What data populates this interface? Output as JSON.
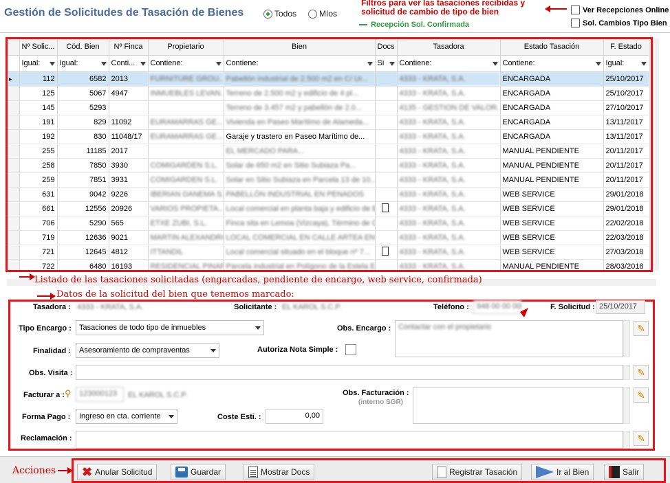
{
  "header": {
    "title": "Gestión de Solicitudes de Tasación de Bienes",
    "radio_todos": "Todos",
    "radio_mios": "Míos",
    "legend": "Recepción Sol. Confirmada",
    "chk_recepciones": "Ver Recepciones Online",
    "chk_cambios": "Sol. Cambios Tipo Bien"
  },
  "annotations": {
    "filters": "Filtros para ver las tasaciones recibidas y solicitud de cambio de tipo de bien",
    "listado": "Listado de las tasaciones solicitadas (engarcadas, pendiente de encargo, web service, confirmada)",
    "datos": "Datos de la solicitud del bien que tenemos marcado:",
    "acciones": "Acciones"
  },
  "grid": {
    "columns": [
      "Nº Solic...",
      "Cód. Bien",
      "Nº Finca",
      "Propietario",
      "Bien",
      "Docs",
      "Tasadora",
      "Estado Tasación",
      "F. Estado"
    ],
    "filters": [
      "Igual:",
      "Igual:",
      "Conti...",
      "Contiene:",
      "Contiene:",
      "Si",
      "Contiene:",
      "Contiene:",
      "Igual:"
    ],
    "rows": [
      {
        "sol": "112",
        "cod": "6582",
        "finca": "2013",
        "prop": "FURNITURE GROU...",
        "bien": "Pabellón industrial de 2.500 m2 en C/ Ur...",
        "docs": "",
        "tas": "4333 - KRATA, S.A.",
        "estado": "ENCARGADA",
        "fecha": "25/10/2017"
      },
      {
        "sol": "125",
        "cod": "5067",
        "finca": "4947",
        "prop": "INMUEBLES LEVAN...",
        "bien": "Terreno de 2.500 m2 y edificio de 4 pl...",
        "docs": "",
        "tas": "4333 - KRATA, S.A.",
        "estado": "ENCARGADA",
        "fecha": "25/10/2017"
      },
      {
        "sol": "145",
        "cod": "5293",
        "finca": "",
        "prop": "",
        "bien": "Terreno de 3.457 m2 y pabellón de 2.0...",
        "docs": "",
        "tas": "4135 - GESTION DE VALOR...",
        "estado": "ENCARGADA",
        "fecha": "27/10/2017"
      },
      {
        "sol": "191",
        "cod": "829",
        "finca": "11092",
        "prop": "EURAMARRAS GE...",
        "bien": "Vivienda en Paseo Marítimo de Alameda...",
        "docs": "",
        "tas": "4333 - KRATA, S.A.",
        "estado": "ENCARGADA",
        "fecha": "13/11/2017"
      },
      {
        "sol": "192",
        "cod": "830",
        "finca": "11048/17",
        "prop": "EURAMARRAS GE...",
        "bien": "Garaje y trastero en Paseo Marítimo de...",
        "docs": "",
        "tas": "4333 - KRATA, S.A.",
        "estado": "ENCARGADA",
        "fecha": "13/11/2017"
      },
      {
        "sol": "255",
        "cod": "11185",
        "finca": "2017",
        "prop": "",
        "bien": "EL MERCADO PARA...",
        "docs": "",
        "tas": "4333 - KRATA, S.A.",
        "estado": "MANUAL PENDIENTE",
        "fecha": "20/11/2017"
      },
      {
        "sol": "258",
        "cod": "7850",
        "finca": "3930",
        "prop": "COMIGARDEN S.L.",
        "bien": "Solar de 650 m2 en Sitio Subiaza Pa...",
        "docs": "",
        "tas": "4333 - KRATA, S.A.",
        "estado": "MANUAL PENDIENTE",
        "fecha": "20/11/2017"
      },
      {
        "sol": "259",
        "cod": "7851",
        "finca": "3931",
        "prop": "COMIGARDEN S.L.",
        "bien": "Solar en Sitio Subiaza en Parcela 13 de 10...",
        "docs": "",
        "tas": "4333 - KRATA, S.A.",
        "estado": "MANUAL PENDIENTE",
        "fecha": "20/11/2017"
      },
      {
        "sol": "631",
        "cod": "9042",
        "finca": "9226",
        "prop": "IBERIAN DANEMA S...",
        "bien": "PABELLÓN INDUSTRIAL EN PENADOS",
        "docs": "",
        "tas": "4333 - KRATA, S.A.",
        "estado": "WEB SERVICE",
        "fecha": "29/01/2018"
      },
      {
        "sol": "661",
        "cod": "12556",
        "finca": "20926",
        "prop": "VARIOS PROPIETA...",
        "bien": "Local comercial en planta baja y edificio de Engel...",
        "docs": "doc",
        "tas": "4333 - KRATA, S.A.",
        "estado": "WEB SERVICE",
        "fecha": "29/01/2018"
      },
      {
        "sol": "706",
        "cod": "5290",
        "finca": "565",
        "prop": "ETXE ZUBI, S.L.",
        "bien": "Finca sita en Lemoa (Vizcaya), Término de Ca...",
        "docs": "",
        "tas": "4333 - KRATA, S.A.",
        "estado": "WEB SERVICE",
        "fecha": "22/02/2018"
      },
      {
        "sol": "719",
        "cod": "12636",
        "finca": "9021",
        "prop": "MARTIN ALEXANDRO...",
        "bien": "LOCAL COMERCIAL EN CALLE ARTEA ENTRAM...",
        "docs": "",
        "tas": "4333 - KRATA, S.A.",
        "estado": "WEB SERVICE",
        "fecha": "22/03/2018"
      },
      {
        "sol": "721",
        "cod": "12645",
        "finca": "4812",
        "prop": "ITTANDIL",
        "bien": "Local comercial situado en el bloque nº 7...",
        "docs": "doc",
        "tas": "4333 - KRATA, S.A.",
        "estado": "WEB SERVICE",
        "fecha": "27/03/2018"
      },
      {
        "sol": "722",
        "cod": "6480",
        "finca": "16193",
        "prop": "RESIDENCIAL PINAR...",
        "bien": "Parcela industrial en Polígono de la Estela E...",
        "docs": "",
        "tas": "4333 - KRATA, S.A.",
        "estado": "MANUAL PENDIENTE",
        "fecha": "28/03/2018"
      }
    ]
  },
  "detail": {
    "tasadora_label": "Tasadora :",
    "tasadora_value": "4333 - KRATA, S.A.",
    "solicitante_label": "Solicitante :",
    "solicitante_value": "EL KAROL S.C.P.",
    "telefono_label": "Teléfono :",
    "telefono_value": "948 00 00 00",
    "fsolicitud_label": "F. Solicitud :",
    "fsolicitud_value": "25/10/2017",
    "tipo_label": "Tipo Encargo :",
    "tipo_value": "Tasaciones de todo tipo de inmuebles",
    "obs_encargo_label": "Obs. Encargo :",
    "obs_encargo_value": "Contactar con el propietario",
    "finalidad_label": "Finalidad :",
    "finalidad_value": "Asesoramiento de compraventas",
    "autoriza_label": "Autoriza Nota Simple :",
    "obs_visita_label": "Obs. Visita :",
    "facturar_label": "Facturar a :",
    "facturar_code": "123000123",
    "facturar_name": "EL KAROL S.C.P.",
    "obs_fact_label": "Obs. Facturación :",
    "obs_fact_sub": "(interno SGR)",
    "forma_label": "Forma Pago :",
    "forma_value": "Ingreso en cta. corriente",
    "coste_label": "Coste Esti. :",
    "coste_value": "0,00",
    "reclamacion_label": "Reclamación :"
  },
  "actions": {
    "anular": "Anular Solicitud",
    "guardar": "Guardar",
    "docs": "Mostrar Docs",
    "registrar": "Registrar Tasación",
    "ir_bien": "Ir al Bien",
    "salir": "Salir"
  },
  "colors": {
    "title": "#4a6b9c",
    "annotation": "#d00000",
    "selected_row": "#cfe4f5",
    "legend": "#2e9e3e"
  }
}
